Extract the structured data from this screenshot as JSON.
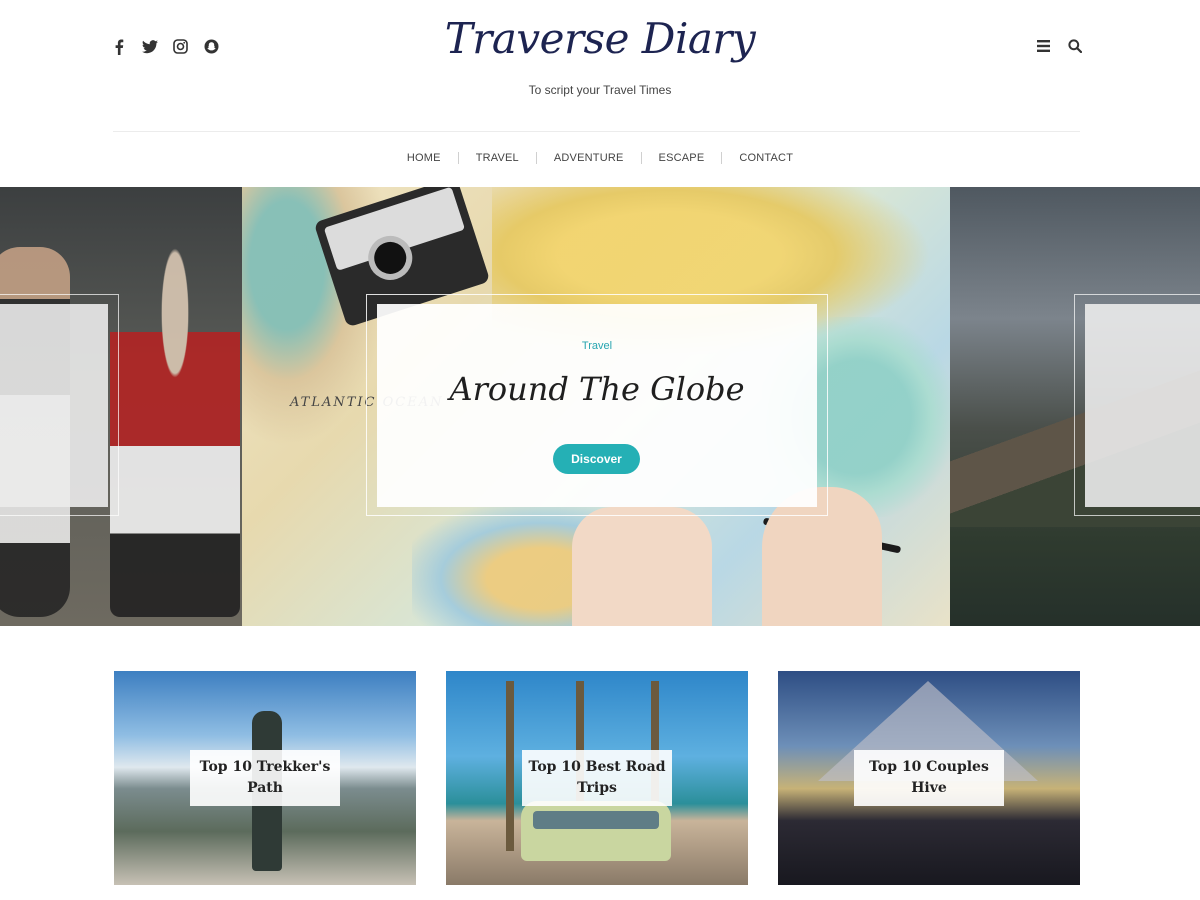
{
  "site": {
    "title": "Traverse Diary",
    "tagline": "To script your Travel Times"
  },
  "social_icons": [
    "facebook-icon",
    "twitter-icon",
    "instagram-icon",
    "snapchat-icon"
  ],
  "header_tools": [
    "menu-icon",
    "search-icon"
  ],
  "nav": {
    "items": [
      "HOME",
      "TRAVEL",
      "ADVENTURE",
      "ESCAPE",
      "CONTACT"
    ]
  },
  "hero": {
    "category": "Travel",
    "title": "Around The Globe",
    "button_label": "Discover",
    "map_label": "ATLANTIC OCEAN"
  },
  "featured": [
    {
      "title": "Top 10 Trekker's Path"
    },
    {
      "title": "Top 10 Best Road Trips"
    },
    {
      "title": "Top 10 Couples Hive"
    }
  ],
  "colors": {
    "accent": "#25b0b5",
    "category": "#27a5b0",
    "logo": "#1d2451"
  }
}
